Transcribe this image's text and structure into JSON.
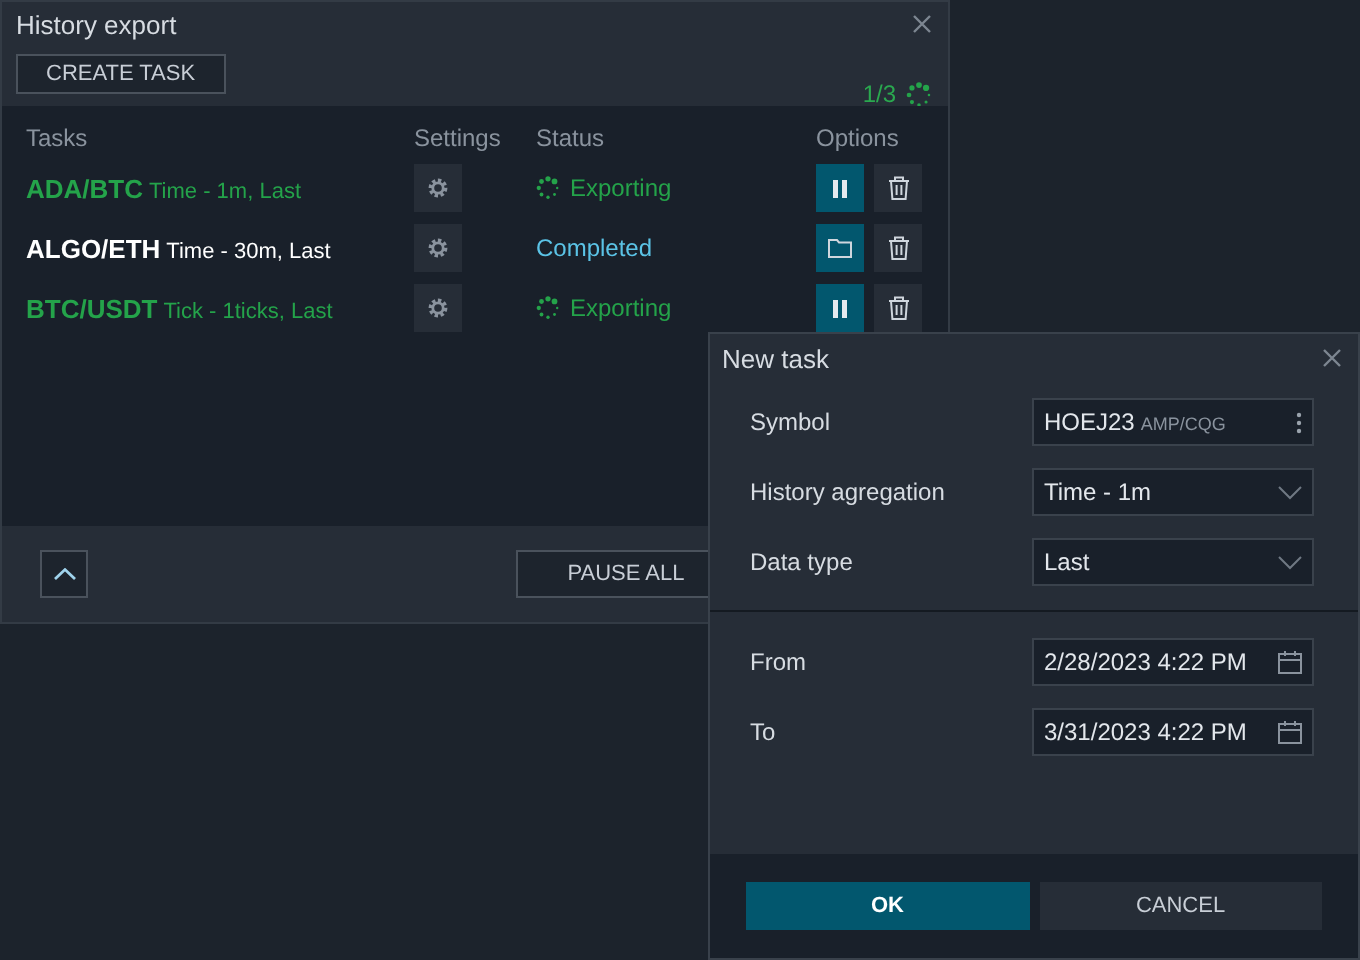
{
  "history_window": {
    "title": "History export",
    "create_button": "CREATE TASK",
    "progress": "1/3",
    "columns": [
      "Tasks",
      "Settings",
      "Status",
      "Options"
    ],
    "tasks": [
      {
        "symbol": "ADA/BTC",
        "detail": "Time - 1m, Last",
        "kind": "exporting",
        "status_text": "Exporting"
      },
      {
        "symbol": "ALGO/ETH",
        "detail": "Time - 30m, Last",
        "kind": "completed",
        "status_text": "Completed"
      },
      {
        "symbol": "BTC/USDT",
        "detail": "Tick - 1ticks, Last",
        "kind": "exporting",
        "status_text": "Exporting"
      }
    ],
    "pause_all_button": "PAUSE ALL"
  },
  "new_task_dialog": {
    "title": "New task",
    "fields": [
      {
        "label": "Symbol",
        "kind": "symbol",
        "value": "HOEJ23",
        "exchange": "AMP/CQG"
      },
      {
        "label": "History agregation",
        "kind": "select",
        "value": "Time - 1m"
      },
      {
        "label": "Data type",
        "kind": "select",
        "value": "Last"
      }
    ],
    "range": [
      {
        "label": "From",
        "kind": "date",
        "value": "2/28/2023 4:22 PM"
      },
      {
        "label": "To",
        "kind": "date",
        "value": "3/31/2023 4:22 PM"
      }
    ],
    "buttons": [
      "OK",
      "CANCEL"
    ]
  }
}
